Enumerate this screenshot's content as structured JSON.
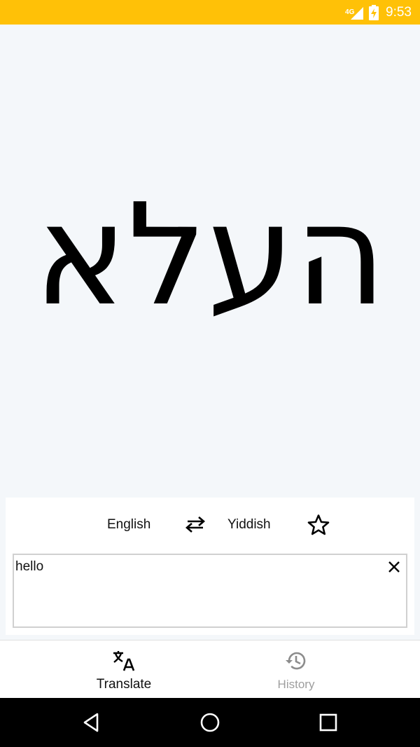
{
  "status_bar": {
    "network": "4G",
    "time": "9:53",
    "icons": [
      "signal-icon",
      "battery-charging-icon"
    ],
    "background": "#ffc107"
  },
  "main": {
    "translated_text": "העלא",
    "background": "#f4f7fa"
  },
  "translator": {
    "source_language": "English",
    "target_language": "Yiddish",
    "swap_icon": "swap-arrows-icon",
    "favorite_icon": "star-outline-icon",
    "input_value": "hello",
    "clear_icon": "close-icon"
  },
  "bottom_nav": {
    "items": [
      {
        "label": "Translate",
        "icon": "translate-icon",
        "active": true
      },
      {
        "label": "History",
        "icon": "history-icon",
        "active": false
      }
    ]
  },
  "system_nav": {
    "icons": [
      "back-icon",
      "home-icon",
      "recents-icon"
    ]
  }
}
